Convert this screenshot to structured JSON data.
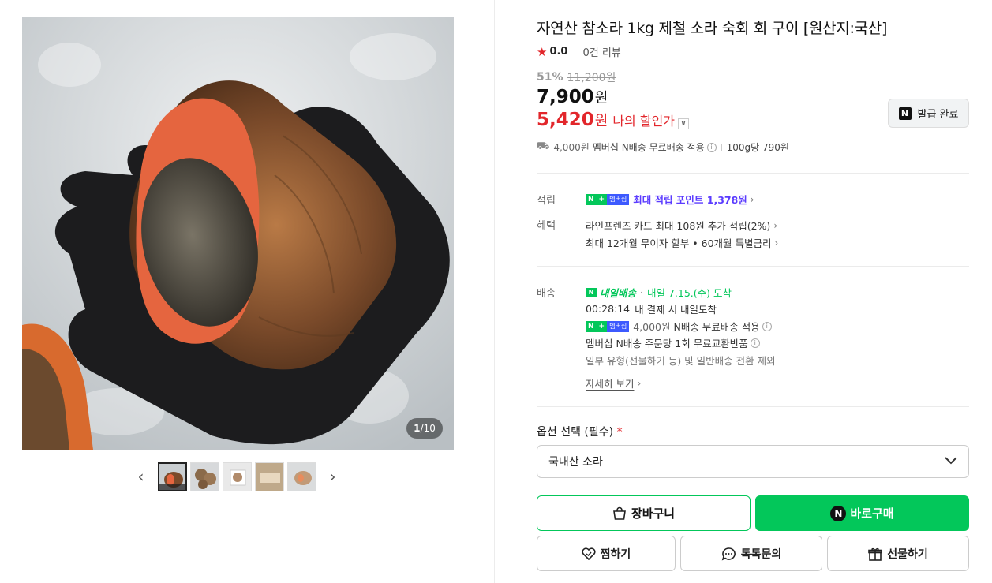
{
  "gallery": {
    "counter_current": "1",
    "counter_total": "/10",
    "prev_label": "‹",
    "next_label": "›",
    "thumbnail_count": 5
  },
  "product": {
    "title": "자연산 참소라 1kg 제철 소라 숙회 회 구이 [원산지:국산]",
    "rating_score": "0.0",
    "review_count": "0건 리뷰",
    "discount_pct": "51%",
    "original_price": "11,200원",
    "sale_price": "7,900",
    "won": "원",
    "my_price": "5,420",
    "my_price_label": "나의 할인가",
    "coupon_label": "발급 완료"
  },
  "shipping_summary": {
    "old_fee": "4,000원",
    "text": "멤버십 N배송 무료배송 적용",
    "unit_price": "100g당 790원"
  },
  "benefits": {
    "points_label": "적립",
    "points_text": "최대 적립 포인트 1,378원",
    "benefit_label": "혜택",
    "benefit_line1": "라인프렌즈 카드 최대 108원 추가 적립(2%)",
    "benefit_line2": "최대 12개월 무이자 할부 • 60개월 특별금리"
  },
  "delivery": {
    "label": "배송",
    "badge": "내일배송",
    "arrival": "내일 7.15.(수) 도착",
    "countdown": "00:28:14",
    "countdown_text": "내 결제 시 내일도착",
    "old_fee": "4,000원",
    "free_text": "N배송 무료배송 적용",
    "exchange_text": "멤버십 N배송 주문당 1회 무료교환반품",
    "exclusion_text": "일부 유형(선물하기 등) 및 일반배송 전환 제외",
    "details_link": "자세히 보기"
  },
  "badge": {
    "n": "N",
    "plus": "+",
    "membership": "멤버십"
  },
  "options": {
    "label": "옵션 선택 (필수)",
    "required_mark": "*",
    "selected": "국내산 소라"
  },
  "actions": {
    "cart": "장바구니",
    "buy": "바로구매",
    "wish": "찜하기",
    "talk": "톡톡문의",
    "gift": "선물하기"
  },
  "colors": {
    "brand_green": "#03c75a",
    "price_red": "#e2262b",
    "points_purple": "#5b3cff"
  }
}
